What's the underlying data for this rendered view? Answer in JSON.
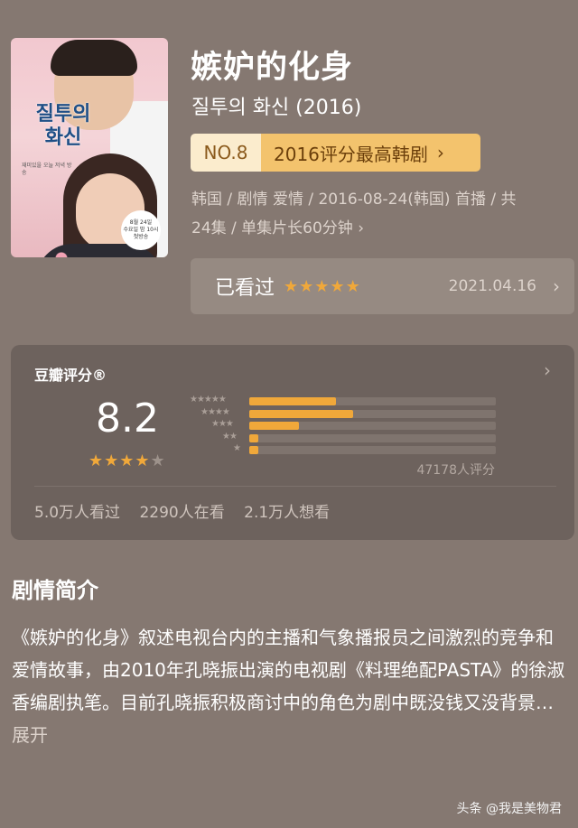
{
  "poster": {
    "title_line1": "질투의",
    "title_line2": "화신",
    "small_text": "재미있을 오늘 저녁 방송",
    "badge_line1": "8월 24일",
    "badge_line2": "수요일 밤 10시",
    "badge_line3": "첫방송"
  },
  "movie": {
    "title": "嫉妒的化身",
    "subtitle": "질투의 화신 (2016)",
    "rank_no": "NO.8",
    "rank_text": "2016评分最高韩剧",
    "meta_line1": "韩国 / 剧情 爱情 / 2016-08-24(韩国) 首播 / 共",
    "meta_line2": "24集 / 单集片长60分钟",
    "meta_chev": "›"
  },
  "watched": {
    "label": "已看过",
    "stars": "★★★★★",
    "date": "2021.04.16",
    "chev": "›"
  },
  "rating": {
    "title": "豆瓣评分®",
    "chev": "›",
    "score": "8.2",
    "stars_on": "★★★★",
    "stars_off": "★",
    "count": "47178人评分",
    "stats": {
      "watched": "5.0万人看过",
      "watching": "2290人在看",
      "want": "2.1万人想看"
    },
    "distribution": [
      {
        "stars": "★★★★★",
        "fraction": 0.35
      },
      {
        "stars": "★★★★",
        "fraction": 0.42
      },
      {
        "stars": "★★★",
        "fraction": 0.2
      },
      {
        "stars": "★★",
        "fraction": 0.035
      },
      {
        "stars": "★",
        "fraction": 0.035
      }
    ]
  },
  "synopsis": {
    "title": "剧情简介",
    "text": "《嫉妒的化身》叙述电视台内的主播和气象播报员之间激烈的竞争和爱情故事，由2010年孔晓振出演的电视剧《料理绝配PASTA》的徐淑香编剧执笔。目前孔晓振积极商讨中的角色为剧中既没钱又没背景…",
    "more": "展开"
  },
  "watermark": "头条 @我是美物君",
  "colors": {
    "background": "#857871",
    "accent": "#f0a83a",
    "card": "#6d625d"
  }
}
